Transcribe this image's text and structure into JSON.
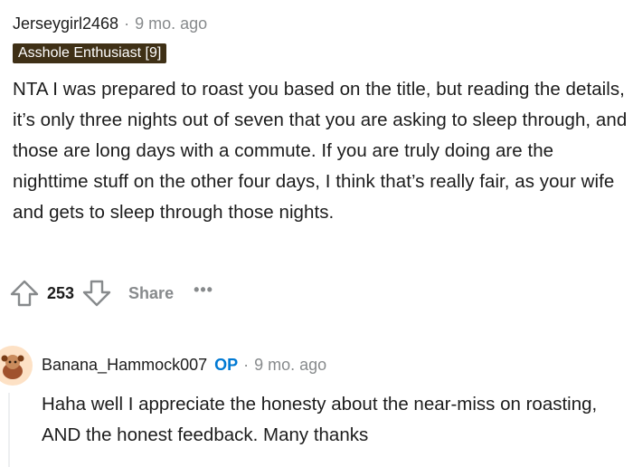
{
  "comment": {
    "username": "Jerseygirl2468",
    "separator": "·",
    "time": "9 mo. ago",
    "flair": "Asshole Enthusiast [9]",
    "flair_color": "#3f3016",
    "body": "NTA I was prepared to roast you based on the title, but reading the details, it’s only three nights out of seven that you are asking to sleep through, and those are long days with a commute. If you are truly doing are the nighttime stuff on the other four days, I think that’s really fair, as your wife and gets to sleep through those nights.",
    "score": "253",
    "share_label": "Share",
    "more_label": "•••",
    "icons": [
      "upvote-icon",
      "downvote-icon",
      "more-icon"
    ]
  },
  "reply": {
    "username": "Banana_Hammock007",
    "op_badge": "OP",
    "op_color": "#0079d3",
    "separator": "·",
    "time": "9 mo. ago",
    "body": "Haha well I appreciate the honesty about the near-miss on roasting, AND the honest feedback. Many thanks",
    "avatar_icon": "snoo-avatar-icon"
  }
}
